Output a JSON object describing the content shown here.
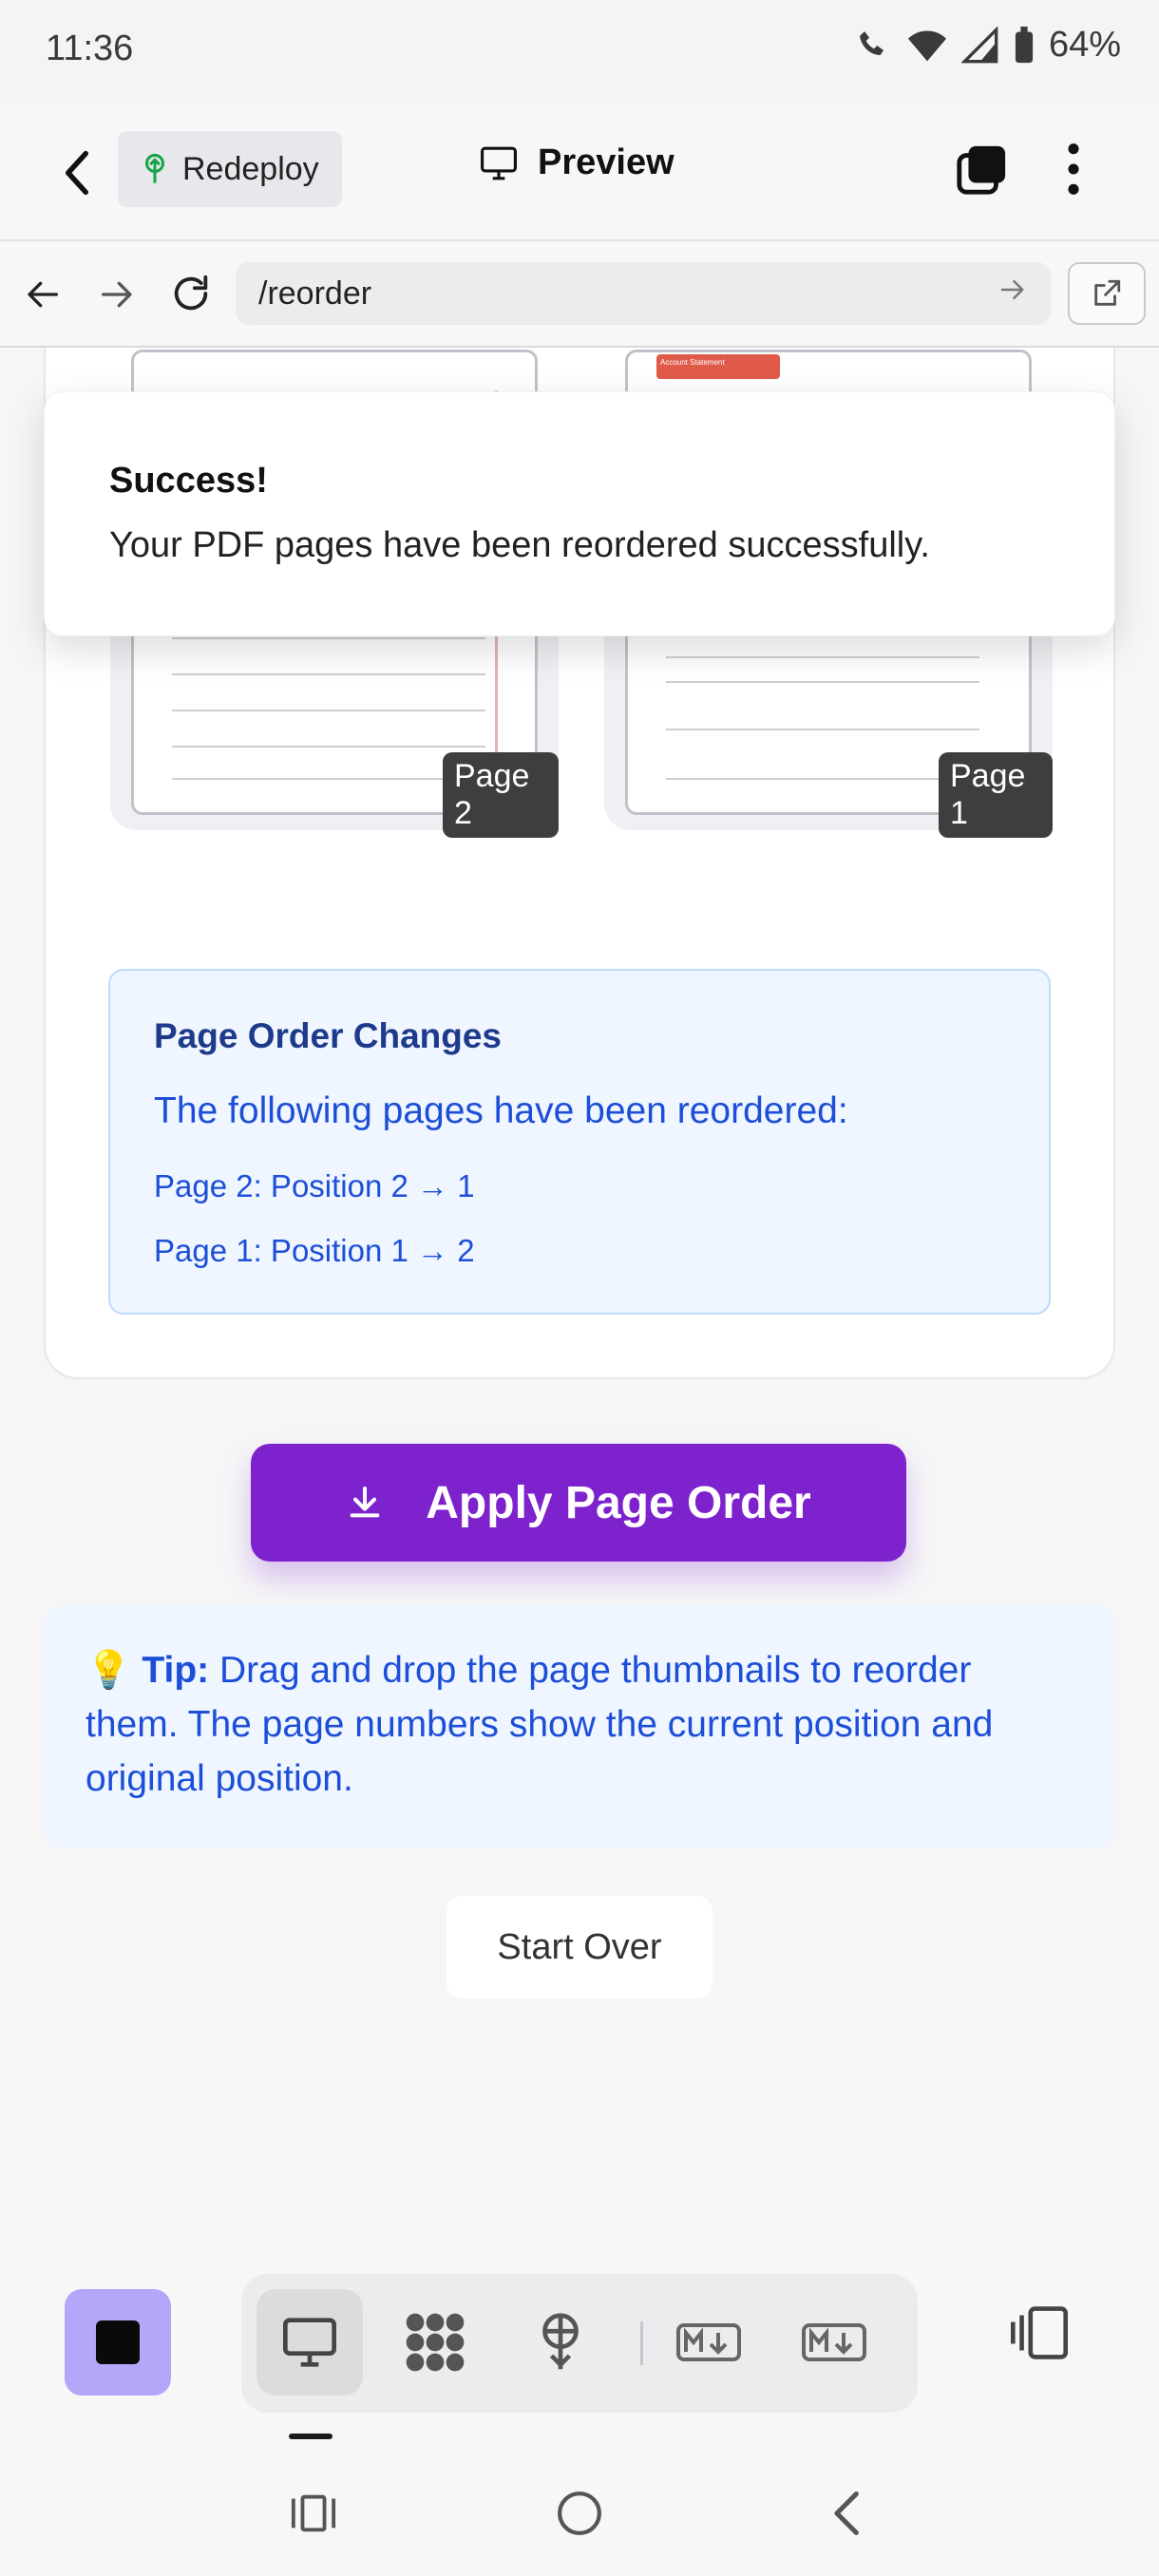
{
  "status_bar": {
    "time": "11:36",
    "battery": "64%"
  },
  "toolbar": {
    "redeploy_label": "Redeploy",
    "preview_label": "Preview"
  },
  "url_bar": {
    "url": "/reorder"
  },
  "thumbnails": [
    {
      "badge": "Page 2",
      "header_text": ""
    },
    {
      "badge": "Page 1",
      "header_text": "Account Statement"
    }
  ],
  "toast": {
    "title": "Success!",
    "message": "Your PDF pages have been reordered successfully."
  },
  "order_changes": {
    "title": "Page Order Changes",
    "subtitle": "The following pages have been reordered:",
    "items": [
      "Page 2: Position 2 → 1",
      "Page 1: Position 1 → 2"
    ]
  },
  "apply_button": {
    "label": "Apply Page Order",
    "icon": "download-icon"
  },
  "tip": {
    "emoji": "💡",
    "label": "Tip:",
    "text": "Drag and drop the page thumbnails to reorder them. The page numbers show the current position and original position."
  },
  "start_over": {
    "label": "Start Over"
  },
  "colors": {
    "accent": "#7e22ce",
    "info_bg": "#eff6ff",
    "info_text": "#1d4ed8",
    "stop_button": "#b4a6f9"
  }
}
